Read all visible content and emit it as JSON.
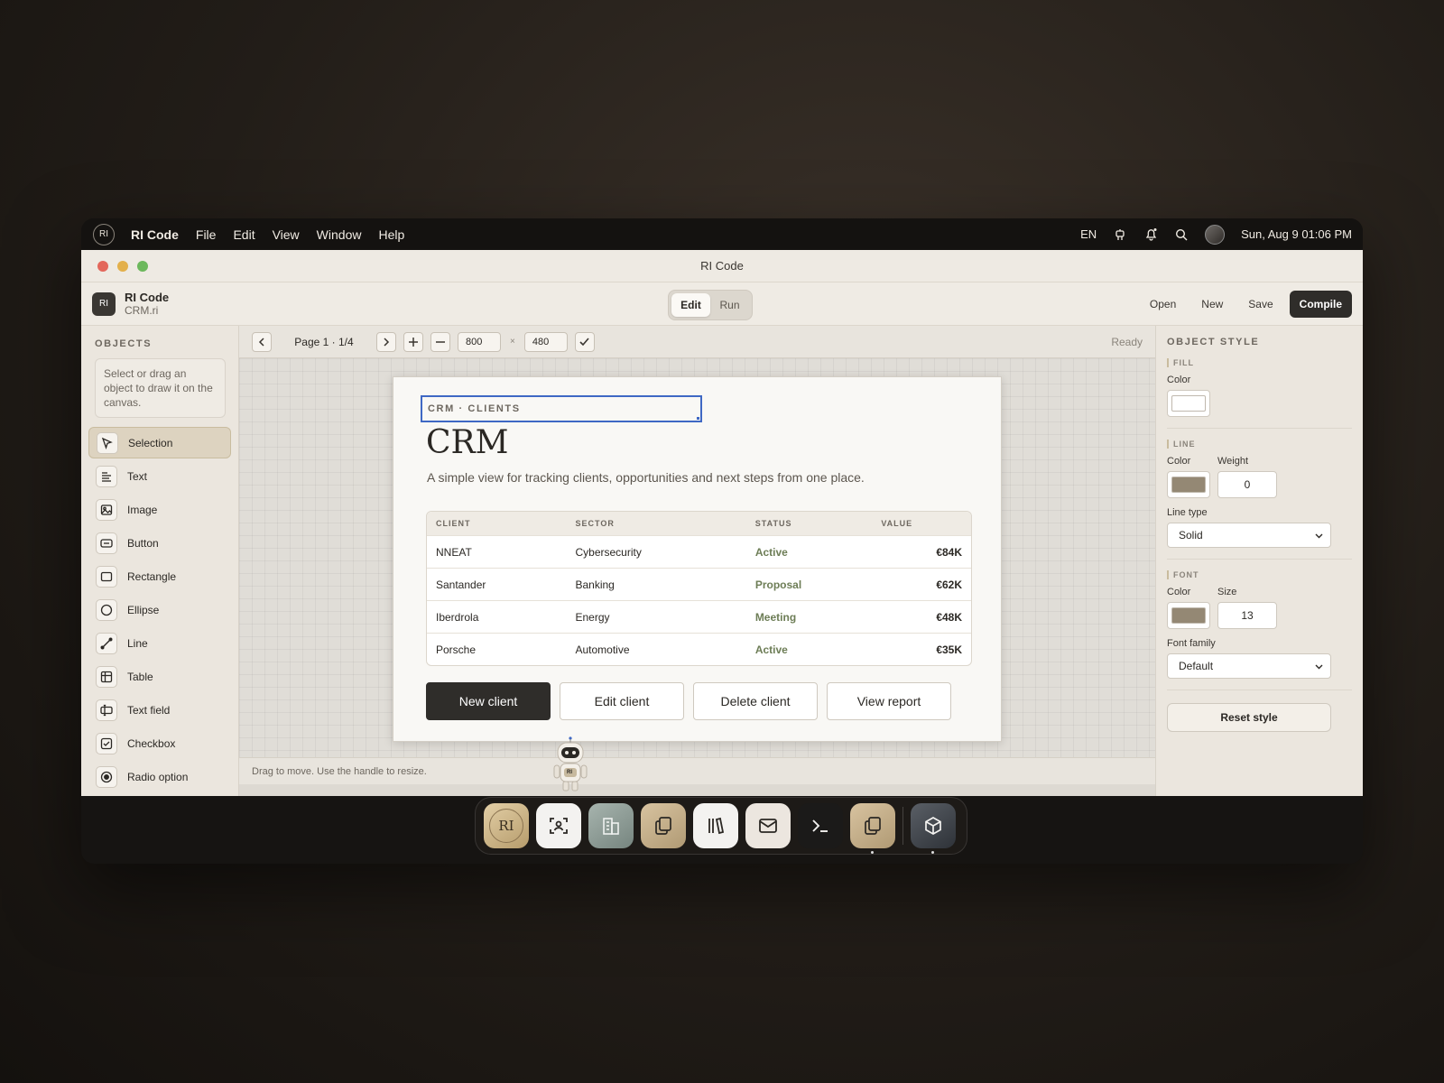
{
  "menubar": {
    "logo": "RI",
    "items": [
      "RI Code",
      "File",
      "Edit",
      "View",
      "Window",
      "Help"
    ],
    "lang": "EN",
    "datetime": "Sun, Aug 9 01:06 PM"
  },
  "window": {
    "title": "RI Code"
  },
  "toolbar": {
    "badge": "RI",
    "app_name": "RI Code",
    "file_name": "CRM.ri",
    "mode_edit": "Edit",
    "mode_run": "Run",
    "open": "Open",
    "new": "New",
    "save": "Save",
    "compile": "Compile"
  },
  "objects": {
    "heading": "OBJECTS",
    "hint": "Select or drag an object to draw it on the canvas.",
    "tools": [
      {
        "label": "Selection",
        "icon": "cursor-icon"
      },
      {
        "label": "Text",
        "icon": "text-icon"
      },
      {
        "label": "Image",
        "icon": "image-icon"
      },
      {
        "label": "Button",
        "icon": "button-icon"
      },
      {
        "label": "Rectangle",
        "icon": "rectangle-icon"
      },
      {
        "label": "Ellipse",
        "icon": "ellipse-icon"
      },
      {
        "label": "Line",
        "icon": "line-icon"
      },
      {
        "label": "Table",
        "icon": "table-icon"
      },
      {
        "label": "Text field",
        "icon": "text-field-icon"
      },
      {
        "label": "Checkbox",
        "icon": "checkbox-icon"
      },
      {
        "label": "Radio option",
        "icon": "radio-icon"
      }
    ]
  },
  "canvas": {
    "page_label": "Page 1 · 1/4",
    "width": "800",
    "times": "×",
    "height": "480",
    "status": "Ready",
    "footer_hint": "Drag to move. Use the handle to resize."
  },
  "doc": {
    "eyebrow": "CRM · CLIENTS",
    "title": "CRM",
    "subtitle": "A simple view for tracking clients, opportunities and next steps from one place.",
    "columns": [
      "CLIENT",
      "SECTOR",
      "STATUS",
      "VALUE"
    ],
    "rows": [
      {
        "client": "NNEAT",
        "sector": "Cybersecurity",
        "status": "Active",
        "value": "€84K"
      },
      {
        "client": "Santander",
        "sector": "Banking",
        "status": "Proposal",
        "value": "€62K"
      },
      {
        "client": "Iberdrola",
        "sector": "Energy",
        "status": "Meeting",
        "value": "€48K"
      },
      {
        "client": "Porsche",
        "sector": "Automotive",
        "status": "Active",
        "value": "€35K"
      }
    ],
    "buttons": [
      "New client",
      "Edit client",
      "Delete client",
      "View report"
    ]
  },
  "style_panel": {
    "heading": "OBJECT STYLE",
    "fill_heading": "FILL",
    "fill_color_label": "Color",
    "fill_color": "#ffffff",
    "line_heading": "LINE",
    "line_color_label": "Color",
    "line_color": "#948874",
    "weight_label": "Weight",
    "weight": "0",
    "line_type_label": "Line type",
    "line_type": "Solid",
    "font_heading": "FONT",
    "font_color_label": "Color",
    "font_color": "#948874",
    "size_label": "Size",
    "size": "13",
    "font_family_label": "Font family",
    "font_family": "Default",
    "reset": "Reset style"
  },
  "robot_badge": "RI",
  "dock": {
    "apps": [
      "ri-app-icon",
      "face-scan-icon",
      "building-icon",
      "files-icon",
      "library-icon",
      "mail-icon",
      "terminal-icon",
      "files-icon",
      "cube-icon"
    ],
    "ri_label": "RI"
  }
}
